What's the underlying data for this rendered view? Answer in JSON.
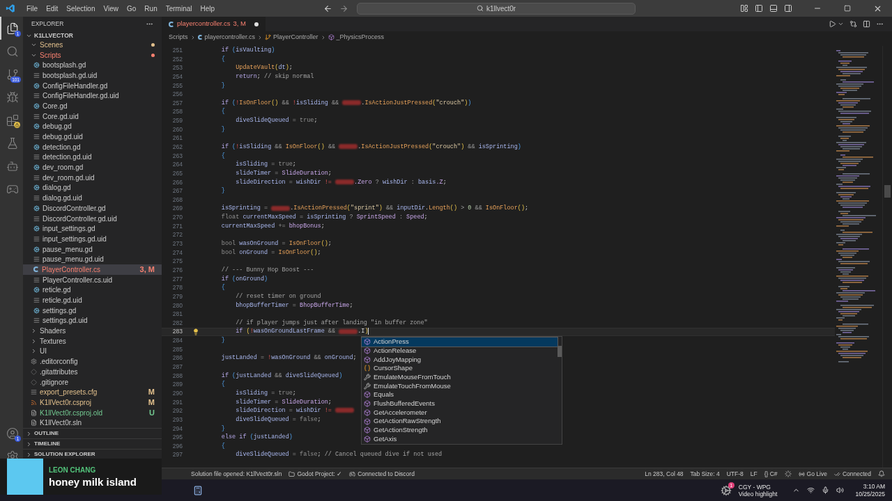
{
  "title_bar": {
    "menus": [
      "File",
      "Edit",
      "Selection",
      "View",
      "Go",
      "Run",
      "Terminal",
      "Help"
    ],
    "search": {
      "value": "k1llvect0r"
    }
  },
  "activity_bar": {
    "top": [
      {
        "kind": "explorer",
        "selected": true,
        "badge": "1"
      },
      {
        "kind": "search",
        "selected": false
      },
      {
        "kind": "source-control",
        "selected": false,
        "badge": "101"
      },
      {
        "kind": "run-debug",
        "selected": false
      },
      {
        "kind": "extensions",
        "selected": false,
        "warning": true
      },
      {
        "kind": "testing",
        "selected": false
      },
      {
        "kind": "godot",
        "selected": false
      },
      {
        "kind": "python",
        "selected": false
      }
    ],
    "bottom": [
      {
        "kind": "accounts",
        "selected": false,
        "badge": "1"
      },
      {
        "kind": "settings",
        "selected": false
      }
    ]
  },
  "explorer": {
    "title": "EXPLORER",
    "root": {
      "label": "K1LLVECTOR",
      "expanded": true,
      "children": [
        {
          "label": "Scenes",
          "kind": "folder",
          "expanded": true,
          "color": "#e2c08d",
          "selected": false
        },
        {
          "label": "Scripts",
          "kind": "folder",
          "expanded": true,
          "color": "#f88070",
          "selected": false,
          "children": [
            {
              "label": "bootsplash.gd",
              "kind": "gd",
              "selected": false
            },
            {
              "label": "bootsplash.gd.uid",
              "kind": "uid",
              "selected": false
            },
            {
              "label": "ConfigFileHandler.gd",
              "kind": "gd",
              "selected": false
            },
            {
              "label": "ConfigFileHandler.gd.uid",
              "kind": "uid",
              "selected": false
            },
            {
              "label": "Core.gd",
              "kind": "gd",
              "selected": false
            },
            {
              "label": "Core.gd.uid",
              "kind": "uid",
              "selected": false
            },
            {
              "label": "debug.gd",
              "kind": "gd",
              "selected": false
            },
            {
              "label": "debug.gd.uid",
              "kind": "uid",
              "selected": false
            },
            {
              "label": "detection.gd",
              "kind": "gd",
              "selected": false
            },
            {
              "label": "detection.gd.uid",
              "kind": "uid",
              "selected": false
            },
            {
              "label": "dev_room.gd",
              "kind": "gd",
              "selected": false
            },
            {
              "label": "dev_room.gd.uid",
              "kind": "uid",
              "selected": false
            },
            {
              "label": "dialog.gd",
              "kind": "gd",
              "selected": false
            },
            {
              "label": "dialog.gd.uid",
              "kind": "uid",
              "selected": false
            },
            {
              "label": "DiscordController.gd",
              "kind": "gd",
              "selected": false
            },
            {
              "label": "DiscordController.gd.uid",
              "kind": "uid",
              "selected": false
            },
            {
              "label": "input_settings.gd",
              "kind": "gd",
              "selected": false
            },
            {
              "label": "input_settings.gd.uid",
              "kind": "uid",
              "selected": false
            },
            {
              "label": "pause_menu.gd",
              "kind": "gd",
              "selected": false
            },
            {
              "label": "pause_menu.gd.uid",
              "kind": "uid",
              "selected": false
            },
            {
              "label": "PlayerController.cs",
              "kind": "cs",
              "color": "#f88070",
              "badge": "3, M",
              "selected": true
            },
            {
              "label": "PlayerController.cs.uid",
              "kind": "uid",
              "selected": false
            },
            {
              "label": "reticle.gd",
              "kind": "gd",
              "selected": false
            },
            {
              "label": "reticle.gd.uid",
              "kind": "uid",
              "selected": false
            },
            {
              "label": "settings.gd",
              "kind": "gd",
              "selected": false
            },
            {
              "label": "settings.gd.uid",
              "kind": "uid",
              "selected": false
            }
          ]
        },
        {
          "label": "Shaders",
          "kind": "folder",
          "expanded": false,
          "selected": false
        },
        {
          "label": "Textures",
          "kind": "folder",
          "expanded": false,
          "selected": false
        },
        {
          "label": "UI",
          "kind": "folder",
          "expanded": false,
          "selected": false
        },
        {
          "label": ".editorconfig",
          "kind": "config",
          "selected": false
        },
        {
          "label": ".gitattributes",
          "kind": "git",
          "selected": false
        },
        {
          "label": ".gitignore",
          "kind": "git",
          "selected": false
        },
        {
          "label": "export_presets.cfg",
          "kind": "uid",
          "color": "#e2c08d",
          "badge": "M",
          "selected": false
        },
        {
          "label": "K1llVect0r.csproj",
          "kind": "rss",
          "color": "#e2c08d",
          "badge": "M",
          "selected": false
        },
        {
          "label": "K1llVect0r.csproj.old",
          "kind": "text",
          "color": "#73c991",
          "badge": "U",
          "selected": false
        },
        {
          "label": "K1llVect0r.sln",
          "kind": "text",
          "selected": false
        }
      ]
    },
    "sections": [
      {
        "label": "OUTLINE",
        "expanded": false
      },
      {
        "label": "TIMELINE",
        "expanded": false
      },
      {
        "label": "SOLUTION EXPLORER",
        "expanded": false
      }
    ]
  },
  "tab": {
    "label": "playercontroller.cs",
    "badge": "3, M",
    "dirty": true
  },
  "breadcrumbs": [
    {
      "label": "Scripts",
      "kind": "folder"
    },
    {
      "label": "playercontroller.cs",
      "kind": "cs"
    },
    {
      "label": "PlayerController",
      "kind": "class"
    },
    {
      "label": "_PhysicsProcess",
      "kind": "method"
    }
  ],
  "code": [
    {
      "n": "251",
      "tokens": [
        {
          "s": "        if ",
          "kind": "keyword"
        },
        {
          "s": "(",
          "kind": "bracket"
        },
        {
          "s": "isVaulting",
          "kind": "variable"
        },
        {
          "s": ")",
          "kind": "bracket"
        }
      ]
    },
    {
      "n": "252",
      "tokens": [
        {
          "s": "        {",
          "kind": "bracket"
        }
      ]
    },
    {
      "n": "253",
      "tokens": [
        {
          "s": "            UpdateVault",
          "kind": "method"
        },
        {
          "s": "(",
          "kind": "callbracket"
        },
        {
          "s": "dt",
          "kind": "variable"
        },
        {
          "s": ")",
          "kind": "callbracket"
        },
        {
          "s": ";",
          "kind": "punct"
        }
      ]
    },
    {
      "n": "254",
      "tokens": [
        {
          "s": "            return",
          "kind": "keyword"
        },
        {
          "s": ";",
          "kind": "punct"
        },
        {
          "s": " // skip normal",
          "kind": "comment"
        }
      ]
    },
    {
      "n": "255",
      "tokens": [
        {
          "s": "        }",
          "kind": "bracket"
        }
      ]
    },
    {
      "n": "256"
    },
    {
      "n": "257",
      "tokens": [
        {
          "s": "        if ",
          "kind": "keyword"
        },
        {
          "s": "(",
          "kind": "bracket"
        },
        {
          "s": "!",
          "kind": "negation"
        },
        {
          "s": "IsOnFloor",
          "kind": "method"
        },
        {
          "s": "()",
          "kind": "callbracket"
        },
        {
          "s": " && ",
          "kind": "operator"
        },
        {
          "s": "!",
          "kind": "negation"
        },
        {
          "s": "isSliding",
          "kind": "variable"
        },
        {
          "s": " && ",
          "kind": "operator"
        },
        {
          "kind": "redacted"
        },
        {
          "s": ".",
          "kind": "punct"
        },
        {
          "s": "IsActionJustPressed",
          "kind": "method"
        },
        {
          "s": "(",
          "kind": "callbracket"
        },
        {
          "s": "\"crouch\"",
          "kind": "string"
        },
        {
          "s": ")",
          "kind": "callbracket"
        },
        {
          "s": ")",
          "kind": "bracket"
        }
      ]
    },
    {
      "n": "258",
      "tokens": [
        {
          "s": "        {",
          "kind": "bracket"
        }
      ]
    },
    {
      "n": "259",
      "tokens": [
        {
          "s": "            diveSlideQueued",
          "kind": "variable"
        },
        {
          "s": " = ",
          "kind": "operator"
        },
        {
          "s": "true",
          "kind": "literal"
        },
        {
          "s": ";",
          "kind": "punct"
        }
      ]
    },
    {
      "n": "260",
      "tokens": [
        {
          "s": "        }",
          "kind": "bracket"
        }
      ]
    },
    {
      "n": "261"
    },
    {
      "n": "262",
      "tokens": [
        {
          "s": "        if ",
          "kind": "keyword"
        },
        {
          "s": "(",
          "kind": "bracket"
        },
        {
          "s": "!",
          "kind": "negation"
        },
        {
          "s": "isSliding",
          "kind": "variable"
        },
        {
          "s": " && ",
          "kind": "operator"
        },
        {
          "s": "IsOnFloor",
          "kind": "method"
        },
        {
          "s": "()",
          "kind": "callbracket"
        },
        {
          "s": " && ",
          "kind": "operator"
        },
        {
          "kind": "redacted"
        },
        {
          "s": ".",
          "kind": "punct"
        },
        {
          "s": "IsActionJustPressed",
          "kind": "method"
        },
        {
          "s": "(",
          "kind": "callbracket"
        },
        {
          "s": "\"crouch\"",
          "kind": "string"
        },
        {
          "s": ")",
          "kind": "callbracket"
        },
        {
          "s": " && ",
          "kind": "operator"
        },
        {
          "s": "isSprinting",
          "kind": "variable"
        },
        {
          "s": ")",
          "kind": "bracket"
        }
      ]
    },
    {
      "n": "263",
      "tokens": [
        {
          "s": "        {",
          "kind": "bracket"
        }
      ]
    },
    {
      "n": "264",
      "tokens": [
        {
          "s": "            isSliding",
          "kind": "variable"
        },
        {
          "s": " = ",
          "kind": "operator"
        },
        {
          "s": "true",
          "kind": "literal"
        },
        {
          "s": ";",
          "kind": "punct"
        }
      ]
    },
    {
      "n": "265",
      "tokens": [
        {
          "s": "            slideTimer",
          "kind": "variable"
        },
        {
          "s": " = ",
          "kind": "operator"
        },
        {
          "s": "SlideDuration",
          "kind": "field"
        },
        {
          "s": ";",
          "kind": "punct"
        }
      ]
    },
    {
      "n": "266",
      "tokens": [
        {
          "s": "            slideDirection",
          "kind": "variable"
        },
        {
          "s": " = ",
          "kind": "operator"
        },
        {
          "s": "wishDir",
          "kind": "variable"
        },
        {
          "s": " != ",
          "kind": "negation"
        },
        {
          "kind": "redacted"
        },
        {
          "s": ".Zero",
          "kind": "field"
        },
        {
          "s": " ? ",
          "kind": "operator"
        },
        {
          "s": "wishDir",
          "kind": "variable"
        },
        {
          "s": " : ",
          "kind": "operator"
        },
        {
          "s": "basis",
          "kind": "variable"
        },
        {
          "s": ".Z",
          "kind": "field"
        },
        {
          "s": ";",
          "kind": "punct"
        }
      ]
    },
    {
      "n": "267",
      "tokens": [
        {
          "s": "        }",
          "kind": "bracket"
        }
      ]
    },
    {
      "n": "268"
    },
    {
      "n": "269",
      "tokens": [
        {
          "s": "        isSprinting",
          "kind": "variable"
        },
        {
          "s": " = ",
          "kind": "operator"
        },
        {
          "kind": "redacted"
        },
        {
          "s": ".",
          "kind": "punct"
        },
        {
          "s": "IsActionPressed",
          "kind": "method"
        },
        {
          "s": "(",
          "kind": "callbracket"
        },
        {
          "s": "\"sprint\"",
          "kind": "string"
        },
        {
          "s": ")",
          "kind": "callbracket"
        },
        {
          "s": " && ",
          "kind": "operator"
        },
        {
          "s": "inputDir",
          "kind": "variable"
        },
        {
          "s": ".",
          "kind": "punct"
        },
        {
          "s": "Length",
          "kind": "method"
        },
        {
          "s": "()",
          "kind": "callbracket"
        },
        {
          "s": " > ",
          "kind": "operator"
        },
        {
          "s": "0",
          "kind": "number"
        },
        {
          "s": " && ",
          "kind": "operator"
        },
        {
          "s": "IsOnFloor",
          "kind": "method"
        },
        {
          "s": "()",
          "kind": "callbracket"
        },
        {
          "s": ";",
          "kind": "punct"
        }
      ]
    },
    {
      "n": "270",
      "tokens": [
        {
          "s": "        float ",
          "kind": "literal"
        },
        {
          "s": "currentMaxSpeed",
          "kind": "variable"
        },
        {
          "s": " = ",
          "kind": "operator"
        },
        {
          "s": "isSprinting",
          "kind": "variable"
        },
        {
          "s": " ? ",
          "kind": "operator"
        },
        {
          "s": "SprintSpeed",
          "kind": "field"
        },
        {
          "s": " : ",
          "kind": "operator"
        },
        {
          "s": "Speed",
          "kind": "field"
        },
        {
          "s": ";",
          "kind": "punct"
        }
      ]
    },
    {
      "n": "271",
      "tokens": [
        {
          "s": "        currentMaxSpeed",
          "kind": "variable"
        },
        {
          "s": " += ",
          "kind": "operator"
        },
        {
          "s": "bhopBonus",
          "kind": "field"
        },
        {
          "s": ";",
          "kind": "punct"
        }
      ]
    },
    {
      "n": "272"
    },
    {
      "n": "273",
      "tokens": [
        {
          "s": "        bool ",
          "kind": "literal"
        },
        {
          "s": "wasOnGround",
          "kind": "variable"
        },
        {
          "s": " = ",
          "kind": "operator"
        },
        {
          "s": "IsOnFloor",
          "kind": "method"
        },
        {
          "s": "()",
          "kind": "callbracket"
        },
        {
          "s": ";",
          "kind": "punct"
        }
      ]
    },
    {
      "n": "274",
      "tokens": [
        {
          "s": "        bool ",
          "kind": "literal"
        },
        {
          "s": "onGround",
          "kind": "variable"
        },
        {
          "s": " = ",
          "kind": "operator"
        },
        {
          "s": "IsOnFloor",
          "kind": "method"
        },
        {
          "s": "()",
          "kind": "callbracket"
        },
        {
          "s": ";",
          "kind": "punct"
        }
      ]
    },
    {
      "n": "275"
    },
    {
      "n": "276",
      "tokens": [
        {
          "s": "        // --- Bunny Hop Boost ---",
          "kind": "comment"
        }
      ]
    },
    {
      "n": "277",
      "tokens": [
        {
          "s": "        if ",
          "kind": "keyword"
        },
        {
          "s": "(",
          "kind": "bracket"
        },
        {
          "s": "onGround",
          "kind": "variable"
        },
        {
          "s": ")",
          "kind": "bracket"
        }
      ]
    },
    {
      "n": "278",
      "tokens": [
        {
          "s": "        {",
          "kind": "bracket"
        }
      ]
    },
    {
      "n": "279",
      "tokens": [
        {
          "s": "            // reset timer on ground",
          "kind": "comment"
        }
      ]
    },
    {
      "n": "280",
      "tokens": [
        {
          "s": "            bhopBufferTimer",
          "kind": "variable"
        },
        {
          "s": " = ",
          "kind": "operator"
        },
        {
          "s": "BhopBufferTime",
          "kind": "field"
        },
        {
          "s": ";",
          "kind": "punct"
        }
      ]
    },
    {
      "n": "281"
    },
    {
      "n": "282",
      "tokens": [
        {
          "s": "            // if player jumps just after landing \"in buffer zone\"",
          "kind": "comment"
        }
      ]
    },
    {
      "n": "283",
      "current": true,
      "tokens": [
        {
          "s": "            if ",
          "kind": "keyword"
        },
        {
          "s": "(",
          "kind": "callbracket"
        },
        {
          "s": "!",
          "kind": "negation"
        },
        {
          "s": "wasOnGroundLastFrame",
          "kind": "variable"
        },
        {
          "s": " && ",
          "kind": "operator"
        },
        {
          "kind": "redacted"
        },
        {
          "s": ".I",
          "kind": "punct"
        },
        {
          "s": ")",
          "kind": "callbracket"
        }
      ]
    },
    {
      "n": "284",
      "tokens": [
        {
          "s": "        }",
          "kind": "bracket"
        }
      ]
    },
    {
      "n": "285"
    },
    {
      "n": "286",
      "tokens": [
        {
          "s": "        justLanded",
          "kind": "variable"
        },
        {
          "s": " = ",
          "kind": "operator"
        },
        {
          "s": "!",
          "kind": "negation"
        },
        {
          "s": "wasOnGround",
          "kind": "variable"
        },
        {
          "s": " && ",
          "kind": "operator"
        },
        {
          "s": "onGround",
          "kind": "variable"
        },
        {
          "s": ";",
          "kind": "punct"
        }
      ]
    },
    {
      "n": "287"
    },
    {
      "n": "288",
      "tokens": [
        {
          "s": "        if ",
          "kind": "keyword"
        },
        {
          "s": "(",
          "kind": "bracket"
        },
        {
          "s": "justLanded",
          "kind": "variable"
        },
        {
          "s": " && ",
          "kind": "operator"
        },
        {
          "s": "diveSlideQueued",
          "kind": "variable"
        },
        {
          "s": ")",
          "kind": "bracket"
        }
      ]
    },
    {
      "n": "289",
      "tokens": [
        {
          "s": "        {",
          "kind": "bracket"
        }
      ]
    },
    {
      "n": "290",
      "tokens": [
        {
          "s": "            isSliding",
          "kind": "variable"
        },
        {
          "s": " = ",
          "kind": "operator"
        },
        {
          "s": "true",
          "kind": "literal"
        },
        {
          "s": ";",
          "kind": "punct"
        }
      ]
    },
    {
      "n": "291",
      "tokens": [
        {
          "s": "            slideTimer",
          "kind": "variable"
        },
        {
          "s": " = ",
          "kind": "operator"
        },
        {
          "s": "SlideDuration",
          "kind": "field"
        },
        {
          "s": ";",
          "kind": "punct"
        }
      ]
    },
    {
      "n": "292",
      "tokens": [
        {
          "s": "            slideDirection",
          "kind": "variable"
        },
        {
          "s": " = ",
          "kind": "operator"
        },
        {
          "s": "wishDir",
          "kind": "variable"
        },
        {
          "s": " != ",
          "kind": "negation"
        },
        {
          "kind": "redacted"
        }
      ]
    },
    {
      "n": "293",
      "tokens": [
        {
          "s": "            diveSlideQueued",
          "kind": "variable"
        },
        {
          "s": " = ",
          "kind": "operator"
        },
        {
          "s": "false",
          "kind": "literal"
        },
        {
          "s": ";",
          "kind": "punct"
        }
      ]
    },
    {
      "n": "294",
      "tokens": [
        {
          "s": "        }",
          "kind": "bracket"
        }
      ]
    },
    {
      "n": "295",
      "tokens": [
        {
          "s": "        else if ",
          "kind": "keyword"
        },
        {
          "s": "(",
          "kind": "bracket"
        },
        {
          "s": "justLanded",
          "kind": "variable"
        },
        {
          "s": ")",
          "kind": "bracket"
        }
      ]
    },
    {
      "n": "296",
      "tokens": [
        {
          "s": "        {",
          "kind": "bracket"
        }
      ]
    },
    {
      "n": "297",
      "tokens": [
        {
          "s": "            diveSlideQueued",
          "kind": "variable"
        },
        {
          "s": " = ",
          "kind": "operator"
        },
        {
          "s": "false",
          "kind": "literal"
        },
        {
          "s": ";",
          "kind": "punct"
        },
        {
          "s": " // Cancel queued dive if not used",
          "kind": "comment"
        }
      ]
    }
  ],
  "suggestions": [
    {
      "label": "ActionPress",
      "kind": "method",
      "selected": true
    },
    {
      "label": "ActionRelease",
      "kind": "method",
      "selected": false
    },
    {
      "label": "AddJoyMapping",
      "kind": "method",
      "selected": false
    },
    {
      "label": "CursorShape",
      "kind": "enum",
      "selected": false
    },
    {
      "label": "EmulateMouseFromTouch",
      "kind": "property",
      "selected": false
    },
    {
      "label": "EmulateTouchFromMouse",
      "kind": "property",
      "selected": false
    },
    {
      "label": "Equals",
      "kind": "method",
      "selected": false
    },
    {
      "label": "FlushBufferedEvents",
      "kind": "method",
      "selected": false
    },
    {
      "label": "GetAccelerometer",
      "kind": "method",
      "selected": false
    },
    {
      "label": "GetActionRawStrength",
      "kind": "method",
      "selected": false
    },
    {
      "label": "GetActionStrength",
      "kind": "method",
      "selected": false
    },
    {
      "label": "GetAxis",
      "kind": "method",
      "selected": false
    }
  ],
  "status_bar": {
    "left": [
      {
        "label": "Solution file opened: K1llVect0r.sln",
        "kind": "text"
      },
      {
        "label": "Godot Project: ✓",
        "kind": "folder"
      },
      {
        "label": "Connected to Discord",
        "kind": "discord"
      }
    ],
    "right": [
      {
        "label": "Ln 283, Col 48",
        "kind": "text"
      },
      {
        "label": "Tab Size: 4",
        "kind": "text"
      },
      {
        "label": "UTF-8",
        "kind": "text"
      },
      {
        "label": "LF",
        "kind": "text"
      },
      {
        "label": "{} C#",
        "kind": "text"
      },
      {
        "kind": "spinner"
      },
      {
        "label": "Go Live",
        "kind": "live"
      },
      {
        "label": "Connected",
        "kind": "connected"
      },
      {
        "kind": "bell"
      }
    ]
  },
  "stream_overlay": {
    "name": "LEON CHANG",
    "song": "honey milk island"
  },
  "taskbar": {
    "notification": {
      "badge": "1",
      "title": "CGY - WPG",
      "subtitle": "Video highlight"
    },
    "time": "3:10 AM",
    "date": "10/25/2025"
  }
}
